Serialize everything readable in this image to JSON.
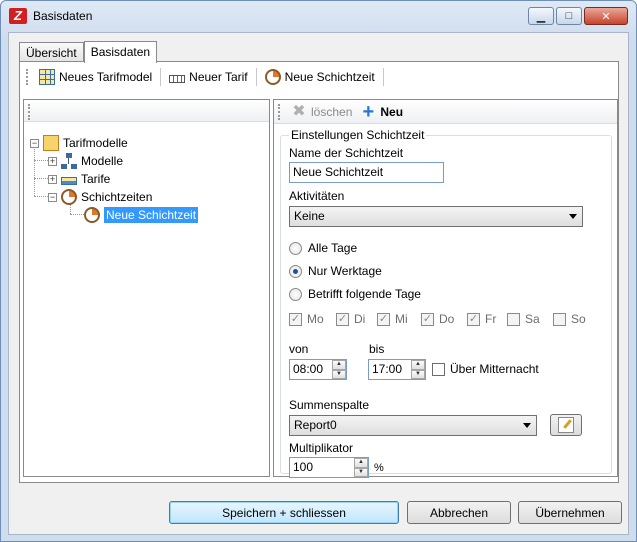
{
  "window": {
    "title": "Basisdaten",
    "minimize_icon": "minimize-icon",
    "maximize_icon": "maximize-icon",
    "close_icon": "close-icon"
  },
  "tabs": [
    {
      "label": "Übersicht",
      "active": false
    },
    {
      "label": "Basisdaten",
      "active": true
    }
  ],
  "toolbar": {
    "new_tariff_model": "Neues Tarifmodel",
    "new_tariff": "Neuer Tarif",
    "new_shift_time": "Neue Schichtzeit"
  },
  "tree": {
    "root": "Tarifmodelle",
    "models": "Modelle",
    "tariffs": "Tarife",
    "shift_times": "Schichtzeiten",
    "selected_item": "Neue Schichtzeit"
  },
  "right_toolbar": {
    "delete_label": "löschen",
    "new_label": "Neu"
  },
  "settings": {
    "group_title": "Einstellungen Schichtzeit",
    "name_label": "Name der Schichtzeit",
    "name_value": "Neue Schichtzeit",
    "activities_label": "Aktivitäten",
    "activities_value": "Keine",
    "radio_all_days": "Alle Tage",
    "radio_workdays": "Nur Werktage",
    "radio_following_days": "Betrifft folgende Tage",
    "selected_radio": "Nur Werktage",
    "days": [
      {
        "label": "Mo",
        "checked": true
      },
      {
        "label": "Di",
        "checked": true
      },
      {
        "label": "Mi",
        "checked": true
      },
      {
        "label": "Do",
        "checked": true
      },
      {
        "label": "Fr",
        "checked": true
      },
      {
        "label": "Sa",
        "checked": false
      },
      {
        "label": "So",
        "checked": false
      }
    ],
    "from_label": "von",
    "from_value": "08:00",
    "to_label": "bis",
    "to_value": "17:00",
    "over_midnight_label": "Über Mitternacht",
    "over_midnight_checked": false,
    "sum_column_label": "Summenspalte",
    "sum_column_value": "Report0",
    "multiplier_label": "Multiplikator",
    "multiplier_value": "100",
    "percent_sign": "%"
  },
  "buttons": {
    "save_close": "Speichern + schliessen",
    "cancel": "Abbrechen",
    "apply": "Übernehmen"
  }
}
